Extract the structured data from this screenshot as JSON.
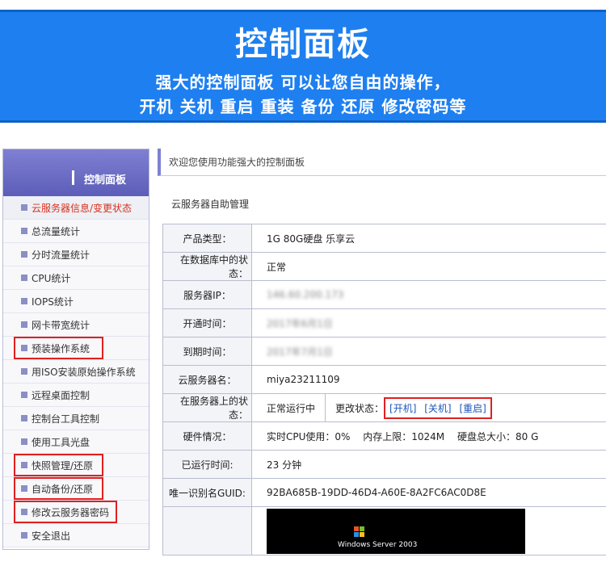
{
  "banner": {
    "title": "控制面板",
    "subtitle": "强大的控制面板 可以让您自由的操作，",
    "subtitle2": "开机 关机 重启 重装 备份 还原 修改密码等"
  },
  "sidebar": {
    "header": "控制面板",
    "items": [
      {
        "label": "云服务器信息/变更状态"
      },
      {
        "label": "总流量统计"
      },
      {
        "label": "分时流量统计"
      },
      {
        "label": "CPU统计"
      },
      {
        "label": "IOPS统计"
      },
      {
        "label": "网卡带宽统计"
      },
      {
        "label": "预装操作系统"
      },
      {
        "label": "用ISO安装原始操作系统"
      },
      {
        "label": "远程桌面控制"
      },
      {
        "label": "控制台工具控制"
      },
      {
        "label": "使用工具光盘"
      },
      {
        "label": "快照管理/还原"
      },
      {
        "label": "自动备份/还原"
      },
      {
        "label": "修改云服务器密码"
      },
      {
        "label": "安全退出"
      }
    ]
  },
  "main": {
    "welcome": "欢迎您使用功能强大的控制面板",
    "section_title": "云服务器自助管理",
    "rows": {
      "product_type": {
        "key": "产品类型：",
        "value": "1G 80G硬盘 乐享云"
      },
      "db_status": {
        "key": "在数据库中的状态：",
        "value": "正常"
      },
      "ip": {
        "key": "服务器IP：",
        "value": "146.60.200.173"
      },
      "open_time": {
        "key": "开通时间：",
        "value": "2017年6月1日"
      },
      "expire_time": {
        "key": "到期时间：",
        "value": "2017年7月1日"
      },
      "server_name": {
        "key": "云服务器名：",
        "value": "miya23211109"
      },
      "server_status": {
        "key": "在服务器上的状态：",
        "value": "正常运行中",
        "change_label": "更改状态：",
        "power_on": "[开机]",
        "power_off": "[关机]",
        "restart": "[重启]"
      },
      "hardware": {
        "key": "硬件情况：",
        "cpu": "实时CPU使用：0%",
        "memory": "内存上限：1024M",
        "disk": "硬盘总大小：80 G"
      },
      "uptime": {
        "key": "已运行时间:",
        "value": "23 分钟"
      },
      "guid": {
        "key": "唯一识别名GUID:",
        "value": "92BA685B-19DD-46D4-A60E-8A2FC6AC0D8E"
      }
    },
    "screen_text": "Windows Server 2003"
  }
}
